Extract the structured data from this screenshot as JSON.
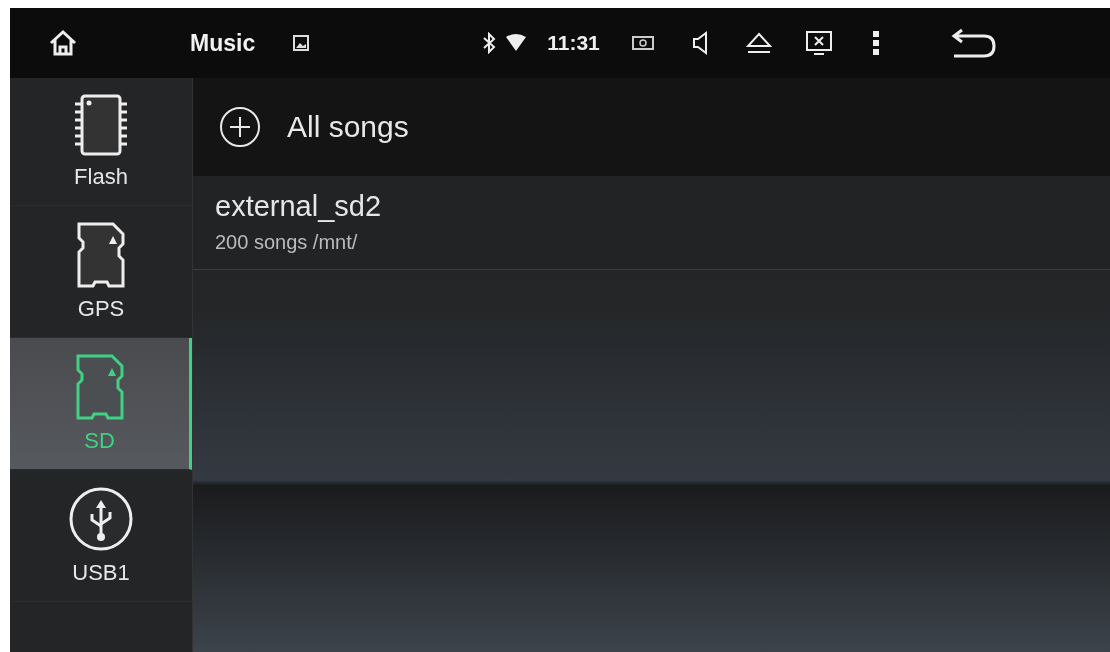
{
  "status_bar": {
    "title": "Music",
    "time": "11:31"
  },
  "sidebar": {
    "items": [
      {
        "label": "Flash",
        "kind": "chip",
        "selected": false
      },
      {
        "label": "GPS",
        "kind": "sd",
        "selected": false
      },
      {
        "label": "SD",
        "kind": "sd",
        "selected": true
      },
      {
        "label": "USB1",
        "kind": "usb",
        "selected": false
      }
    ]
  },
  "header": {
    "label": "All songs"
  },
  "folders": [
    {
      "name": "external_sd2",
      "detail": "200 songs /mnt/"
    }
  ]
}
